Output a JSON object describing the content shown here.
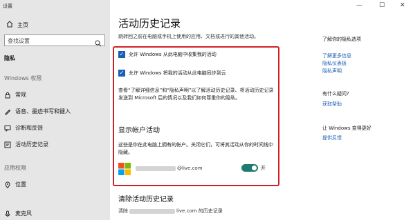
{
  "window": {
    "title": "设置",
    "minimize": "—",
    "maximize": "☐",
    "close": "✕"
  },
  "sidebar": {
    "home": "主页",
    "search_placeholder": "查找设置",
    "privacy_heading": "隐私",
    "windows_permissions": "Windows 权限",
    "items": [
      {
        "label": "常规",
        "icon": "lock-icon"
      },
      {
        "label": "语音、墨迹书写和键入",
        "icon": "pen-icon"
      },
      {
        "label": "诊断和反馈",
        "icon": "feedback-icon"
      },
      {
        "label": "活动历史记录",
        "icon": "history-icon"
      }
    ],
    "app_permissions": "应用权限",
    "app_items": [
      {
        "label": "位置",
        "icon": "location-icon"
      },
      {
        "label": "麦克风",
        "icon": "microphone-icon"
      }
    ]
  },
  "main": {
    "title": "活动历史记录",
    "description": "跳转回之前在电脑或手机上使用的应用、文档或进行的其他活动。",
    "checkbox1": "允许 Windows 从此电脑中收集我的活动",
    "checkbox2": "允许 Windows 将我的活动从此电脑同步到云",
    "paragraph": "查看“了解详细信息”和“隐私声明”以了解活动历史记录、将活动历史记录发送到 Microsoft 后的情况以及我们如何尊重你的隐私。",
    "show_accounts_heading": "显示帐户活动",
    "show_accounts_desc": "这些是你在此电脑上拥有的帐户。关闭它们，可将其活动从你的时间线中隐藏。",
    "account_suffix": "@live.com",
    "toggle_label": "开",
    "clear_heading": "清除活动历史记录",
    "clear_prefix": "清除",
    "clear_suffix": "live.com 的历史记录"
  },
  "right_panel": {
    "know_privacy": "了解你的隐私选项",
    "learn_more": "了解更多信息",
    "privacy_dashboard": "隐私仪表板",
    "privacy_statement": "隐私声明",
    "have_question": "有什么疑问?",
    "get_help": "获取帮助",
    "make_better": "让 Windows 变得更好",
    "give_feedback": "提供反馈"
  },
  "colors": {
    "accent": "#1a5fb4",
    "highlight_border": "#d11f26",
    "toggle_on": "#1f7b70",
    "sidebar_bg": "#e6e6e6"
  }
}
